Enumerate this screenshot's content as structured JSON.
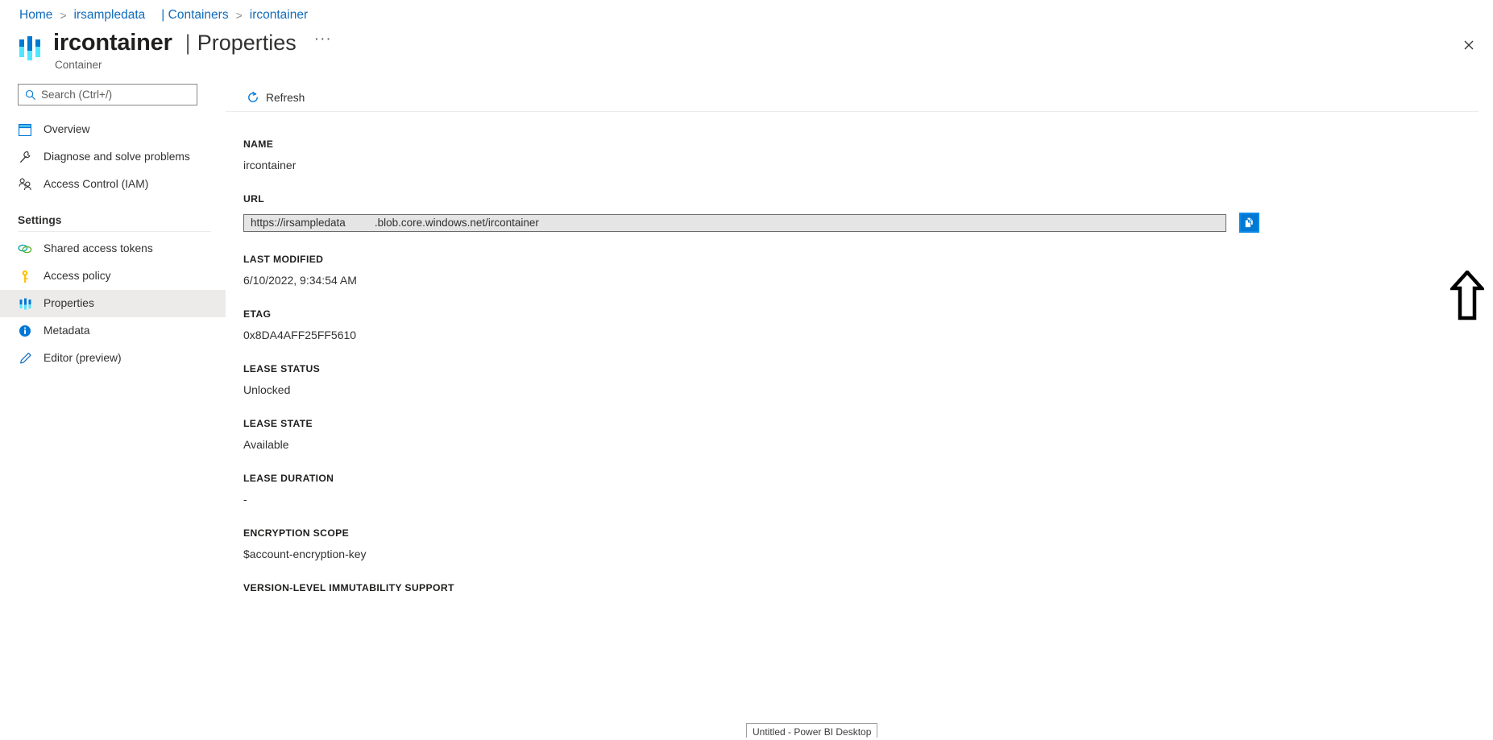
{
  "breadcrumb": {
    "items": [
      {
        "label": "Home",
        "sep": ">"
      },
      {
        "label": "irsampledata",
        "sep": ""
      },
      {
        "label": "| Containers",
        "sep": ">"
      },
      {
        "label": "ircontainer",
        "sep": ""
      }
    ],
    "home": "Home",
    "account": "irsampledata",
    "containers": "| Containers",
    "container": "ircontainer",
    "separator": ">"
  },
  "header": {
    "resource_name": "ircontainer",
    "divider": "|",
    "page_title": "Properties",
    "more_label": "···",
    "subtitle": "Container",
    "close_label": "✕",
    "icon": "container-icon"
  },
  "sidebar": {
    "search": {
      "placeholder": "Search (Ctrl+/)",
      "value": "",
      "icon": "search-icon"
    },
    "collapse_label": "«",
    "items": [
      {
        "label": "Overview",
        "icon": "overview-icon",
        "selected": false
      },
      {
        "label": "Diagnose and solve problems",
        "icon": "wrench-icon",
        "selected": false
      },
      {
        "label": "Access Control (IAM)",
        "icon": "people-icon",
        "selected": false
      }
    ],
    "settings_group": {
      "title": "Settings",
      "items": [
        {
          "label": "Shared access tokens",
          "icon": "link-icon",
          "selected": false
        },
        {
          "label": "Access policy",
          "icon": "key-icon",
          "selected": false
        },
        {
          "label": "Properties",
          "icon": "properties-icon",
          "selected": true
        },
        {
          "label": "Metadata",
          "icon": "info-icon",
          "selected": false
        },
        {
          "label": "Editor (preview)",
          "icon": "pencil-icon",
          "selected": false
        }
      ]
    }
  },
  "toolbar": {
    "refresh_label": "Refresh",
    "refresh_icon": "refresh-icon"
  },
  "main": {
    "properties": [
      {
        "label": "NAME",
        "value": "ircontainer",
        "type": "text"
      },
      {
        "label": "URL",
        "value_prefix": "https://irsampledata",
        "value_suffix": ".blob.core.windows.net/ircontainer",
        "type": "url"
      },
      {
        "label": "LAST MODIFIED",
        "value": "6/10/2022, 9:34:54 AM",
        "type": "text"
      },
      {
        "label": "ETAG",
        "value": "0x8DA4AFF25FF5610",
        "type": "text"
      },
      {
        "label": "LEASE STATUS",
        "value": "Unlocked",
        "type": "text"
      },
      {
        "label": "LEASE STATE",
        "value": "Available",
        "type": "text"
      },
      {
        "label": "LEASE DURATION",
        "value": "-",
        "type": "text"
      },
      {
        "label": "ENCRYPTION SCOPE",
        "value": "$account-encryption-key",
        "type": "text"
      },
      {
        "label": "VERSION-LEVEL IMMUTABILITY SUPPORT",
        "value": "",
        "type": "text"
      }
    ],
    "copy_button": {
      "icon": "copy-icon",
      "title": "Copy to clipboard"
    }
  },
  "annotation": {
    "arrow": "up-arrow-annotation"
  },
  "taskbar": {
    "tooltip": "Untitled - Power BI Desktop"
  },
  "colors": {
    "accent": "#0078d4",
    "link": "#0f6cbd",
    "text": "#323130",
    "selected_bg": "#edebe9",
    "field_bg": "#e5e5e5"
  }
}
